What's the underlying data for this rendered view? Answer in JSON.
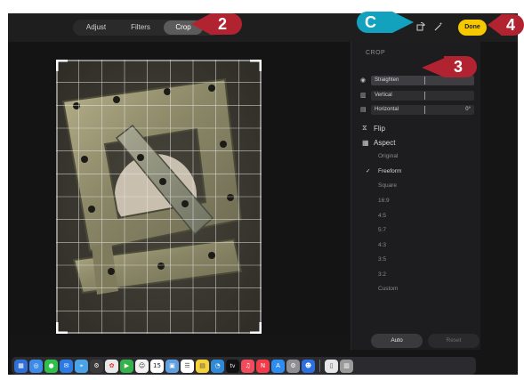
{
  "toolbar": {
    "tabs": [
      {
        "label": "Adjust"
      },
      {
        "label": "Filters"
      },
      {
        "label": "Crop"
      }
    ],
    "done_label": "Done"
  },
  "panel": {
    "title": "CROP",
    "straighten": {
      "label": "Straighten"
    },
    "vertical": {
      "label": "Vertical"
    },
    "horizontal": {
      "label": "Horizontal",
      "value": "0°"
    },
    "flip_label": "Flip",
    "aspect_label": "Aspect",
    "aspect_options": [
      {
        "label": "Original"
      },
      {
        "label": "Freeform",
        "checkmark": "✓"
      },
      {
        "label": "Square"
      },
      {
        "label": "16:9"
      },
      {
        "label": "4:5"
      },
      {
        "label": "5:7"
      },
      {
        "label": "4:3"
      },
      {
        "label": "3:5"
      },
      {
        "label": "3:2"
      },
      {
        "label": "Custom"
      }
    ],
    "auto_label": "Auto",
    "reset_label": "Reset"
  },
  "callouts": {
    "c": "C",
    "crop_tab": "2",
    "straighten": "3",
    "done": "4"
  },
  "colors": {
    "done_yellow": "#f5c800",
    "callout_red": "#b22331",
    "callout_teal": "#13a2bd",
    "panel_bg": "#1d1d1f"
  },
  "dock": {
    "calendar_day": "15",
    "apple_tv": "tv"
  }
}
